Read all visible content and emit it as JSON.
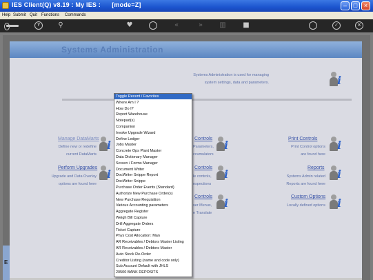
{
  "window": {
    "title": "IES Client(Q) v8.19 : My IES :      [mode=Z]",
    "min_icon": "minimize-icon",
    "max_icon": "maximize-icon",
    "close_icon": "close-icon"
  },
  "menubar": {
    "items": [
      "Help",
      "Submit",
      "Quit",
      "Functions",
      "Commands"
    ]
  },
  "toolbar": {
    "icons": [
      "key-icon",
      "help-icon",
      "search-icon",
      "heart-icon",
      "refresh-icon",
      "back-icon",
      "forward-icon",
      "tag-icon",
      "save-icon",
      "settings-icon",
      "check-icon",
      "close-icon"
    ]
  },
  "header": {
    "title": "Systems Administration"
  },
  "intro": {
    "line1": "Systems Administration is used for managing",
    "line2": "system settings, data and parameters."
  },
  "sections": {
    "manage_datamarts": {
      "label": "Manage DataMarts",
      "line1": "Define new or redefine",
      "line2": "current DataMarts"
    },
    "perform_upgrades": {
      "label": "Perform Upgrades",
      "line1": "Upgrade and Data Overlay",
      "line2": "options are found here"
    },
    "controls_1": {
      "label": "Controls",
      "line1": "Parameters,",
      "line2": "ccumulators"
    },
    "controls_2": {
      "label": "Controls",
      "line1": "le controls,",
      "line2": "nspections"
    },
    "controls_3": {
      "label": "Controls",
      "line1": "ser Menus,",
      "line2": "e Translate"
    },
    "print_controls": {
      "label": "Print Controls",
      "line1": "Print Control options",
      "line2": "are found here"
    },
    "reports": {
      "label": "Reports",
      "line1": "Systems Admin related",
      "line2": "Reports are found here"
    },
    "custom_options": {
      "label": "Custom Options",
      "line1": "Locally defined options"
    }
  },
  "sidebar_letter": "E",
  "popup_menu": {
    "selected_index": 0,
    "items": [
      "Toggle Recent / Favorites",
      "Where Am I ?",
      "How Do I?",
      "Report Warehouse",
      "Notepad(s)",
      "Companion",
      "Invoke Upgrade Wizard",
      "Define Ledger",
      "Jobs Master",
      "Concrete Ops Plant Master",
      "Data Dictionary Manager",
      "Screen / Forms Manager",
      "Document Writer",
      "DocWriter Snippe Report",
      "DocWriter Snippe",
      "Purchase Order Events (Standard)",
      "Authorize New Purchase Order(s)",
      "New Purchase Requisition",
      "Various Accounting parameters",
      "Aggregate Register",
      "Weigh Bill Capture",
      "Drill Aggregate Orders",
      "Ticket Capture",
      "Phys Cost Allocation: Man",
      "AR Receivables / Debtors Master Listing",
      "AR Receivables / Debtors Master",
      "Auto Stock Re-Order",
      "Creditor Listing (name and code only)",
      "Sub Account Default with JHLS",
      "20500 BANK DEPOSITS"
    ]
  }
}
